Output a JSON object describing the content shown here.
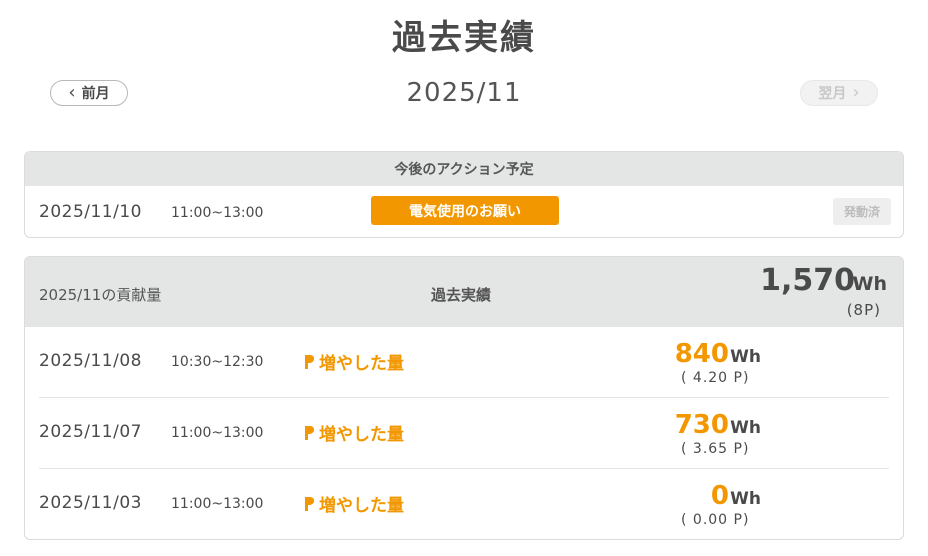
{
  "page": {
    "title": "過去実績",
    "month": "2025/11"
  },
  "nav": {
    "prev_label": "前月",
    "next_label": "翌月"
  },
  "upcoming": {
    "header": "今後のアクション予定",
    "items": [
      {
        "date": "2025/11/10",
        "time": "11:00~13:00",
        "action": "電気使用のお願い",
        "status": "発動済"
      }
    ]
  },
  "contribution": {
    "label": "2025/11の貢献量",
    "section_title": "過去実績",
    "total_value": "1,570",
    "total_unit": "Wh",
    "total_points": "(8P)",
    "rows": [
      {
        "date": "2025/11/08",
        "time": "10:30~12:30",
        "tag": "増やした量",
        "value": "840",
        "unit": "Wh",
        "points": "( 4.20 P)"
      },
      {
        "date": "2025/11/07",
        "time": "11:00~13:00",
        "tag": "増やした量",
        "value": "730",
        "unit": "Wh",
        "points": "( 3.65 P)"
      },
      {
        "date": "2025/11/03",
        "time": "11:00~13:00",
        "tag": "増やした量",
        "value": "0",
        "unit": "Wh",
        "points": "( 0.00 P)"
      }
    ]
  },
  "colors": {
    "accent": "#f39700",
    "header_bg": "#e4e6e5",
    "text": "#4a4a4a"
  },
  "icons": {
    "prev": "chevron-left-icon",
    "next": "chevron-right-icon",
    "increase": "arrow-increase-icon"
  }
}
